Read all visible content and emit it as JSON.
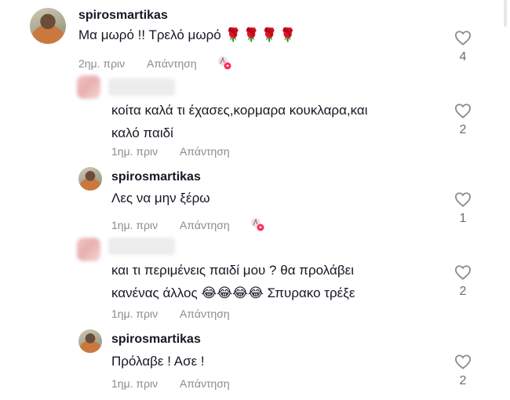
{
  "comments": [
    {
      "username": "spirosmartikas",
      "text_before": "Μα μωρό !! Τρελό μωρό",
      "emoji": "🌹🌹🌹🌹",
      "time": "2ημ. πριν",
      "reply_label": "Απάντηση",
      "likes": "4"
    },
    {
      "text": "κοίτα καλά τι έχασες,κορμαρα κουκλαρα,και καλό παιδί",
      "line1": "κοίτα καλά τι έχασες,κορμαρα κουκλαρα,και",
      "line2": "καλό παιδί",
      "time": "1ημ. πριν",
      "reply_label": "Απάντηση",
      "likes": "2"
    },
    {
      "username": "spirosmartikas",
      "text": "Λες να μην ξέρω",
      "time": "1ημ. πριν",
      "reply_label": "Απάντηση",
      "likes": "1"
    },
    {
      "line1": "και τι περιμένεις παιδί μου ? θα προλάβει",
      "line2_before": "κανένας άλλος",
      "emoji": "😂😂😂😂",
      "line2_after": "Σπυρακο τρέξε",
      "time": "1ημ. πριν",
      "reply_label": "Απάντηση",
      "likes": "2"
    },
    {
      "username": "spirosmartikas",
      "text": "Πρόλαβε ! Ασε !",
      "time": "1ημ. πριν",
      "reply_label": "Απάντηση",
      "likes": "2"
    }
  ],
  "icons": {
    "like": "heart-outline-icon",
    "creator_liked": "creator-liked-badge-icon"
  },
  "colors": {
    "text": "#161823",
    "meta": "#8a8b91",
    "badge": "#fe2c55"
  }
}
